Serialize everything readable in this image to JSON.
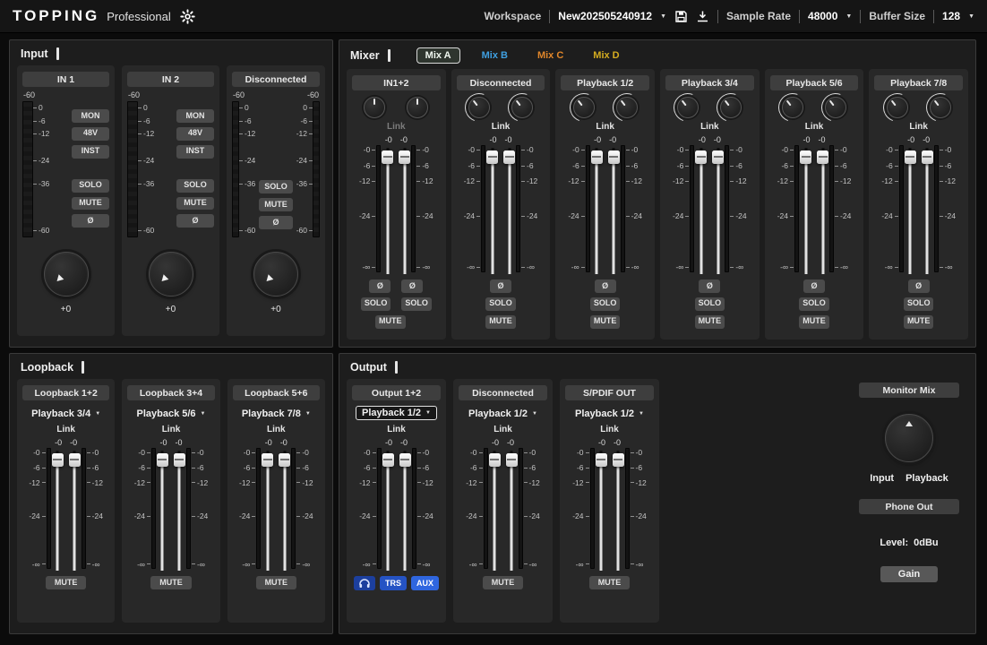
{
  "icons": {
    "dropdown_caret": "▼"
  },
  "topbar": {
    "brand": "TOPPING",
    "brand_sub": "Professional",
    "workspace_label": "Workspace",
    "workspace_value": "New202505240912",
    "sample_rate_label": "Sample Rate",
    "sample_rate_value": "48000",
    "buffer_size_label": "Buffer Size",
    "buffer_size_value": "128"
  },
  "panels": {
    "input": {
      "title": "Input",
      "scale": [
        "0",
        "-6",
        "-12",
        "-24",
        "-36",
        "-60"
      ],
      "channels": [
        {
          "name": "IN 1",
          "peak": "-60",
          "buttons_top": [
            "MON",
            "48V",
            "INST"
          ],
          "buttons_bottom": [
            "SOLO",
            "MUTE",
            "Ø"
          ],
          "gain": "+0"
        },
        {
          "name": "IN 2",
          "peak": "-60",
          "buttons_top": [
            "MON",
            "48V",
            "INST"
          ],
          "buttons_bottom": [
            "SOLO",
            "MUTE",
            "Ø"
          ],
          "gain": "+0"
        },
        {
          "name": "Disconnected",
          "peaks": [
            "-60",
            "-60"
          ],
          "buttons_bottom": [
            "SOLO",
            "MUTE",
            "Ø"
          ],
          "gain": "+0"
        }
      ]
    },
    "mixer": {
      "title": "Mixer",
      "tabs": [
        {
          "label": "Mix A",
          "active": true
        },
        {
          "label": "Mix B",
          "active": false
        },
        {
          "label": "Mix C",
          "active": false
        },
        {
          "label": "Mix D",
          "active": false
        }
      ],
      "scale": [
        "-0",
        "-6",
        "-12",
        "-24",
        "-∞"
      ],
      "channels": [
        {
          "name": "IN1+2",
          "link": "Link",
          "linked": false,
          "values": [
            "-0",
            "-0"
          ],
          "phase": [
            "Ø",
            "Ø"
          ],
          "solo": [
            "SOLO",
            "SOLO"
          ],
          "mute": [
            "MUTE"
          ]
        },
        {
          "name": "Disconnected",
          "link": "Link",
          "linked": true,
          "values": [
            "-0",
            "-0"
          ],
          "phase": [
            "Ø"
          ],
          "solo": [
            "SOLO"
          ],
          "mute": [
            "MUTE"
          ]
        },
        {
          "name": "Playback 1/2",
          "link": "Link",
          "linked": true,
          "values": [
            "-0",
            "-0"
          ],
          "phase": [
            "Ø"
          ],
          "solo": [
            "SOLO"
          ],
          "mute": [
            "MUTE"
          ]
        },
        {
          "name": "Playback 3/4",
          "link": "Link",
          "linked": true,
          "values": [
            "-0",
            "-0"
          ],
          "phase": [
            "Ø"
          ],
          "solo": [
            "SOLO"
          ],
          "mute": [
            "MUTE"
          ]
        },
        {
          "name": "Playback 5/6",
          "link": "Link",
          "linked": true,
          "values": [
            "-0",
            "-0"
          ],
          "phase": [
            "Ø"
          ],
          "solo": [
            "SOLO"
          ],
          "mute": [
            "MUTE"
          ]
        },
        {
          "name": "Playback 7/8",
          "link": "Link",
          "linked": true,
          "values": [
            "-0",
            "-0"
          ],
          "phase": [
            "Ø"
          ],
          "solo": [
            "SOLO"
          ],
          "mute": [
            "MUTE"
          ]
        }
      ]
    },
    "loopback": {
      "title": "Loopback",
      "scale": [
        "-0",
        "-6",
        "-12",
        "-24",
        "-∞"
      ],
      "channels": [
        {
          "name": "Loopback 1+2",
          "source": "Playback 3/4",
          "link": "Link",
          "values": [
            "-0",
            "-0"
          ],
          "mute": [
            "MUTE"
          ]
        },
        {
          "name": "Loopback 3+4",
          "source": "Playback 5/6",
          "link": "Link",
          "values": [
            "-0",
            "-0"
          ],
          "mute": [
            "MUTE"
          ]
        },
        {
          "name": "Loopback 5+6",
          "source": "Playback 7/8",
          "link": "Link",
          "values": [
            "-0",
            "-0"
          ],
          "mute": [
            "MUTE"
          ]
        }
      ]
    },
    "output": {
      "title": "Output",
      "scale": [
        "-0",
        "-6",
        "-12",
        "-24",
        "-∞"
      ],
      "channels": [
        {
          "name": "Output 1+2",
          "source": "Playback 1/2",
          "link": "Link",
          "values": [
            "-0",
            "-0"
          ],
          "trs": "TRS",
          "aux": "AUX"
        },
        {
          "name": "Disconnected",
          "source": "Playback 1/2",
          "link": "Link",
          "values": [
            "-0",
            "-0"
          ],
          "mute": [
            "MUTE"
          ]
        },
        {
          "name": "S/PDIF OUT",
          "source": "Playback 1/2",
          "link": "Link",
          "values": [
            "-0",
            "-0"
          ],
          "mute": [
            "MUTE"
          ]
        }
      ],
      "monitor": {
        "title": "Monitor Mix",
        "input_label": "Input",
        "playback_label": "Playback",
        "phone_title": "Phone Out",
        "level_label": "Level:",
        "level_value": "0dBu",
        "gain_button": "Gain"
      }
    }
  },
  "colors": {
    "mix_a": "#eef6ee",
    "mix_b": "#3f9fe0",
    "mix_c": "#e0862a",
    "mix_d": "#d4ac20",
    "active_blue": "#2f66df"
  }
}
